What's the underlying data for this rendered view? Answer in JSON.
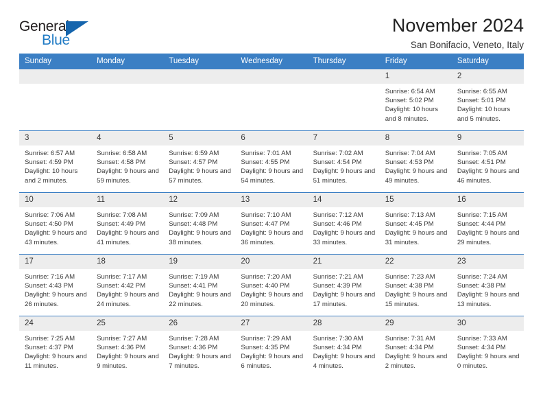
{
  "brand": {
    "name_part1": "General",
    "name_part2": "Blue",
    "accent_color": "#1f7ac4",
    "triangle_color": "#1565ad"
  },
  "header": {
    "title": "November 2024",
    "subtitle": "San Bonifacio, Veneto, Italy"
  },
  "calendar": {
    "header_bg": "#3b7fc4",
    "daynum_bg": "#ededed",
    "weekday_headers": [
      "Sunday",
      "Monday",
      "Tuesday",
      "Wednesday",
      "Thursday",
      "Friday",
      "Saturday"
    ],
    "weeks": [
      [
        {
          "day": "",
          "empty": true
        },
        {
          "day": "",
          "empty": true
        },
        {
          "day": "",
          "empty": true
        },
        {
          "day": "",
          "empty": true
        },
        {
          "day": "",
          "empty": true
        },
        {
          "day": "1",
          "sunrise": "Sunrise: 6:54 AM",
          "sunset": "Sunset: 5:02 PM",
          "daylight": "Daylight: 10 hours and 8 minutes."
        },
        {
          "day": "2",
          "sunrise": "Sunrise: 6:55 AM",
          "sunset": "Sunset: 5:01 PM",
          "daylight": "Daylight: 10 hours and 5 minutes."
        }
      ],
      [
        {
          "day": "3",
          "sunrise": "Sunrise: 6:57 AM",
          "sunset": "Sunset: 4:59 PM",
          "daylight": "Daylight: 10 hours and 2 minutes."
        },
        {
          "day": "4",
          "sunrise": "Sunrise: 6:58 AM",
          "sunset": "Sunset: 4:58 PM",
          "daylight": "Daylight: 9 hours and 59 minutes."
        },
        {
          "day": "5",
          "sunrise": "Sunrise: 6:59 AM",
          "sunset": "Sunset: 4:57 PM",
          "daylight": "Daylight: 9 hours and 57 minutes."
        },
        {
          "day": "6",
          "sunrise": "Sunrise: 7:01 AM",
          "sunset": "Sunset: 4:55 PM",
          "daylight": "Daylight: 9 hours and 54 minutes."
        },
        {
          "day": "7",
          "sunrise": "Sunrise: 7:02 AM",
          "sunset": "Sunset: 4:54 PM",
          "daylight": "Daylight: 9 hours and 51 minutes."
        },
        {
          "day": "8",
          "sunrise": "Sunrise: 7:04 AM",
          "sunset": "Sunset: 4:53 PM",
          "daylight": "Daylight: 9 hours and 49 minutes."
        },
        {
          "day": "9",
          "sunrise": "Sunrise: 7:05 AM",
          "sunset": "Sunset: 4:51 PM",
          "daylight": "Daylight: 9 hours and 46 minutes."
        }
      ],
      [
        {
          "day": "10",
          "sunrise": "Sunrise: 7:06 AM",
          "sunset": "Sunset: 4:50 PM",
          "daylight": "Daylight: 9 hours and 43 minutes."
        },
        {
          "day": "11",
          "sunrise": "Sunrise: 7:08 AM",
          "sunset": "Sunset: 4:49 PM",
          "daylight": "Daylight: 9 hours and 41 minutes."
        },
        {
          "day": "12",
          "sunrise": "Sunrise: 7:09 AM",
          "sunset": "Sunset: 4:48 PM",
          "daylight": "Daylight: 9 hours and 38 minutes."
        },
        {
          "day": "13",
          "sunrise": "Sunrise: 7:10 AM",
          "sunset": "Sunset: 4:47 PM",
          "daylight": "Daylight: 9 hours and 36 minutes."
        },
        {
          "day": "14",
          "sunrise": "Sunrise: 7:12 AM",
          "sunset": "Sunset: 4:46 PM",
          "daylight": "Daylight: 9 hours and 33 minutes."
        },
        {
          "day": "15",
          "sunrise": "Sunrise: 7:13 AM",
          "sunset": "Sunset: 4:45 PM",
          "daylight": "Daylight: 9 hours and 31 minutes."
        },
        {
          "day": "16",
          "sunrise": "Sunrise: 7:15 AM",
          "sunset": "Sunset: 4:44 PM",
          "daylight": "Daylight: 9 hours and 29 minutes."
        }
      ],
      [
        {
          "day": "17",
          "sunrise": "Sunrise: 7:16 AM",
          "sunset": "Sunset: 4:43 PM",
          "daylight": "Daylight: 9 hours and 26 minutes."
        },
        {
          "day": "18",
          "sunrise": "Sunrise: 7:17 AM",
          "sunset": "Sunset: 4:42 PM",
          "daylight": "Daylight: 9 hours and 24 minutes."
        },
        {
          "day": "19",
          "sunrise": "Sunrise: 7:19 AM",
          "sunset": "Sunset: 4:41 PM",
          "daylight": "Daylight: 9 hours and 22 minutes."
        },
        {
          "day": "20",
          "sunrise": "Sunrise: 7:20 AM",
          "sunset": "Sunset: 4:40 PM",
          "daylight": "Daylight: 9 hours and 20 minutes."
        },
        {
          "day": "21",
          "sunrise": "Sunrise: 7:21 AM",
          "sunset": "Sunset: 4:39 PM",
          "daylight": "Daylight: 9 hours and 17 minutes."
        },
        {
          "day": "22",
          "sunrise": "Sunrise: 7:23 AM",
          "sunset": "Sunset: 4:38 PM",
          "daylight": "Daylight: 9 hours and 15 minutes."
        },
        {
          "day": "23",
          "sunrise": "Sunrise: 7:24 AM",
          "sunset": "Sunset: 4:38 PM",
          "daylight": "Daylight: 9 hours and 13 minutes."
        }
      ],
      [
        {
          "day": "24",
          "sunrise": "Sunrise: 7:25 AM",
          "sunset": "Sunset: 4:37 PM",
          "daylight": "Daylight: 9 hours and 11 minutes."
        },
        {
          "day": "25",
          "sunrise": "Sunrise: 7:27 AM",
          "sunset": "Sunset: 4:36 PM",
          "daylight": "Daylight: 9 hours and 9 minutes."
        },
        {
          "day": "26",
          "sunrise": "Sunrise: 7:28 AM",
          "sunset": "Sunset: 4:36 PM",
          "daylight": "Daylight: 9 hours and 7 minutes."
        },
        {
          "day": "27",
          "sunrise": "Sunrise: 7:29 AM",
          "sunset": "Sunset: 4:35 PM",
          "daylight": "Daylight: 9 hours and 6 minutes."
        },
        {
          "day": "28",
          "sunrise": "Sunrise: 7:30 AM",
          "sunset": "Sunset: 4:34 PM",
          "daylight": "Daylight: 9 hours and 4 minutes."
        },
        {
          "day": "29",
          "sunrise": "Sunrise: 7:31 AM",
          "sunset": "Sunset: 4:34 PM",
          "daylight": "Daylight: 9 hours and 2 minutes."
        },
        {
          "day": "30",
          "sunrise": "Sunrise: 7:33 AM",
          "sunset": "Sunset: 4:34 PM",
          "daylight": "Daylight: 9 hours and 0 minutes."
        }
      ]
    ]
  }
}
